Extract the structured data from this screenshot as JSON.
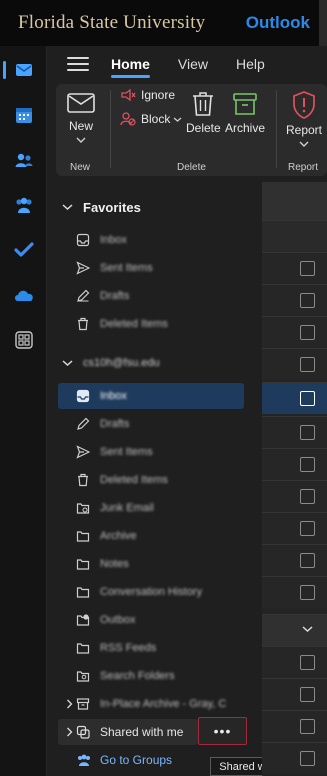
{
  "header": {
    "org_title": "Florida State University",
    "app_title": "Outlook"
  },
  "rail": {
    "items": [
      {
        "icon": "mail-icon",
        "active": true
      },
      {
        "icon": "calendar-icon"
      },
      {
        "icon": "people-icon"
      },
      {
        "icon": "groups-icon"
      },
      {
        "icon": "todo-check-icon"
      },
      {
        "icon": "onedrive-cloud-icon"
      },
      {
        "icon": "apps-grid-icon"
      }
    ]
  },
  "tabs": [
    {
      "label": "Home",
      "active": true
    },
    {
      "label": "View"
    },
    {
      "label": "Help"
    }
  ],
  "ribbon": {
    "new_label": "New",
    "new_group": "New",
    "ignore_label": "Ignore",
    "block_label": "Block",
    "delete_label": "Delete",
    "archive_label": "Archive",
    "delete_group": "Delete",
    "report_label": "Report",
    "report_group": "Report"
  },
  "favorites": {
    "heading": "Favorites",
    "items": [
      {
        "label": "Inbox",
        "icon": "inbox-icon"
      },
      {
        "label": "Sent Items",
        "icon": "send-icon"
      },
      {
        "label": "Drafts",
        "icon": "drafts-pencil-icon"
      },
      {
        "label": "Deleted Items",
        "icon": "trash-icon"
      }
    ]
  },
  "account": {
    "heading": "cs10h@fsu.edu",
    "items": [
      {
        "label": "Inbox",
        "icon": "inbox-icon",
        "selected": true
      },
      {
        "label": "Drafts",
        "icon": "drafts-pencil-icon"
      },
      {
        "label": "Sent Items",
        "icon": "send-icon"
      },
      {
        "label": "Deleted Items",
        "icon": "trash-icon"
      },
      {
        "label": "Junk Email",
        "icon": "junk-folder-icon"
      },
      {
        "label": "Archive",
        "icon": "archive-folder-icon"
      },
      {
        "label": "Notes",
        "icon": "folder-icon"
      },
      {
        "label": "Conversation History",
        "icon": "folder-icon"
      },
      {
        "label": "Outbox",
        "icon": "outbox-folder-icon"
      },
      {
        "label": "RSS Feeds",
        "icon": "folder-icon"
      },
      {
        "label": "Search Folders",
        "icon": "search-folder-icon"
      },
      {
        "label": "In-Place Archive - Gray, C",
        "icon": "archive-box-icon"
      }
    ]
  },
  "shared": {
    "label": "Shared with me",
    "more_label": "•••",
    "tooltip": "Shared with me"
  },
  "groups_link": {
    "label": "Go to Groups"
  },
  "colors": {
    "accent": "#4aa3ff",
    "selected_row": "#1e3a5c",
    "fsu_gold": "#d9c7a2",
    "outlook_blue": "#2b8ae8",
    "report_red": "#e0505f",
    "archive_green": "#7bc46b"
  }
}
